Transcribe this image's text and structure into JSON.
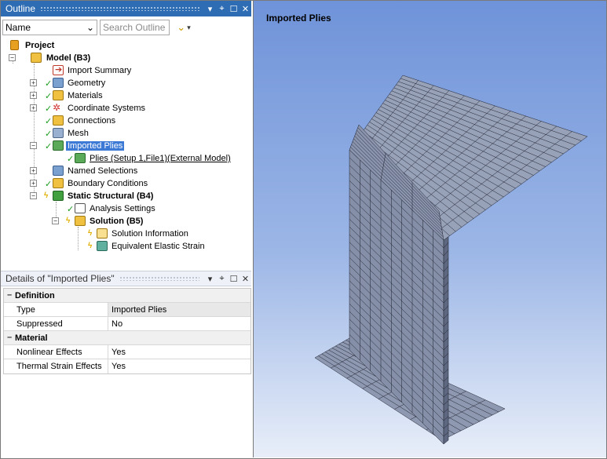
{
  "outline": {
    "title": "Outline",
    "controls": [
      "▾",
      "⌖",
      "☐",
      "✕"
    ],
    "name_select": "Name",
    "search_placeholder": "Search Outline"
  },
  "tree": {
    "project": "Project",
    "model": "Model (B3)",
    "import_summary": "Import Summary",
    "geometry": "Geometry",
    "materials": "Materials",
    "coordinate_systems": "Coordinate Systems",
    "connections": "Connections",
    "mesh": "Mesh",
    "imported_plies": "Imported Plies",
    "plies": "Plies (Setup 1,File1)(External Model)",
    "named_selections": "Named Selections",
    "boundary_conditions": "Boundary Conditions",
    "static_structural": "Static Structural (B4)",
    "analysis_settings": "Analysis Settings",
    "solution": "Solution (B5)",
    "solution_information": "Solution Information",
    "equivalent_elastic_strain": "Equivalent Elastic Strain"
  },
  "details": {
    "title": "Details of \"Imported Plies\"",
    "categories": [
      {
        "name": "Definition",
        "rows": [
          {
            "key": "Type",
            "value": "Imported Plies"
          },
          {
            "key": "Suppressed",
            "value": "No"
          }
        ]
      },
      {
        "name": "Material",
        "rows": [
          {
            "key": "Nonlinear Effects",
            "value": "Yes"
          },
          {
            "key": "Thermal Strain Effects",
            "value": "Yes"
          }
        ]
      }
    ]
  },
  "viewport": {
    "title": "Imported Plies"
  },
  "colors": {
    "title_bar": "#2e6db4",
    "selection": "#3d7ad6",
    "check": "#1a9a1a",
    "mesh_fill": "#8a94ad",
    "mesh_line": "#1e2230"
  }
}
